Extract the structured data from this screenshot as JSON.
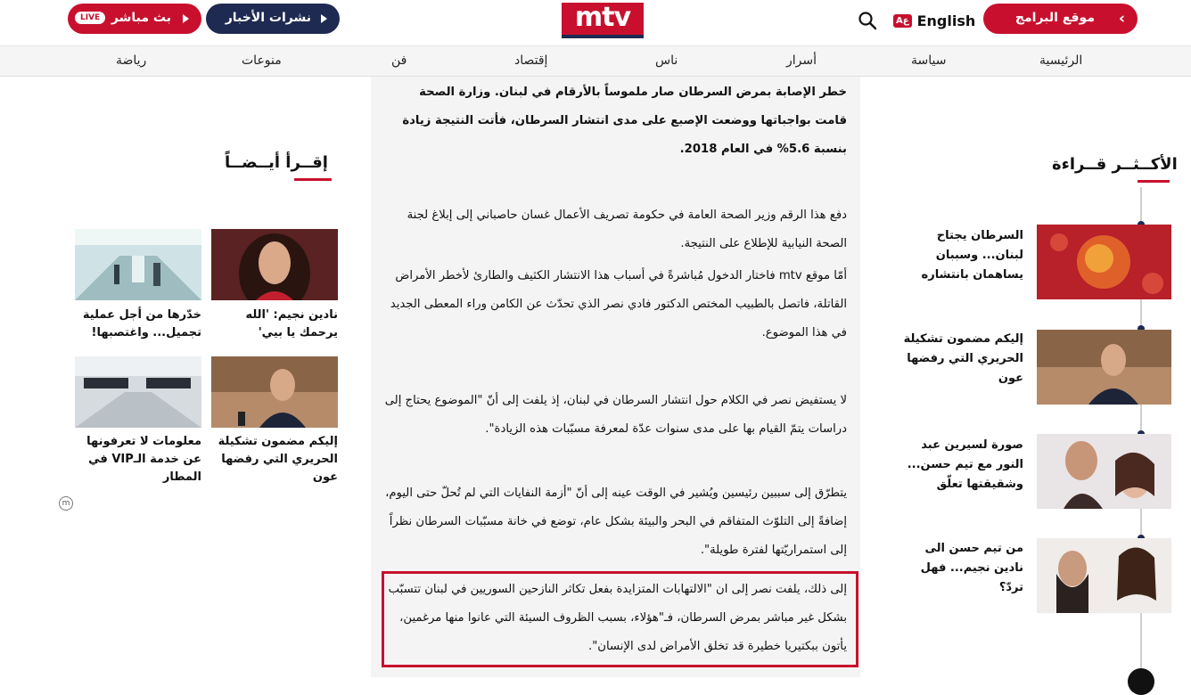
{
  "header": {
    "logo": "mtv",
    "live_label": "بث مباشر",
    "live_badge": "LIVE",
    "news_label": "نشرات الأخبار",
    "programs_label": "موقع البرامج",
    "lang_badge": "Aع",
    "lang_label": "English",
    "icons": [
      "search-icon",
      "play-icon",
      "chevron-left-icon"
    ]
  },
  "nav": {
    "items": [
      "الرئيسية",
      "سياسة",
      "أسرار",
      "ناس",
      "إقتصاد",
      "فن",
      "منوعات",
      "رياضة"
    ]
  },
  "article": {
    "p1": "خطر الإصابة بمرض السرطان صار ملموساً بالأرقام في لبنان. وزارة الصحة قامت بواجباتها ووضعت الإصبع على مدى انتشار السرطان، فأتت النتيجة زيادة بنسبة 5.6% في العام 2018.",
    "p2": "دفع هذا الرقم وزير الصحة العامة في حكومة تصريف الأعمال غسان حاصباني إلى إبلاغ لجنة الصحة النيابية للإطلاع على النتيجة.",
    "p3": "أمّا موقع mtv فاختار الدخول مُباشرةً في أسباب هذا الانتشار الكثيف والطارئ لأخطر الأمراض القاتلة، فاتصل بالطبيب المختص الدكتور فادي نصر الذي تحدّث عن الكامن وراء المعطى الجديد في هذا الموضوع.",
    "p4": "لا يستفيض نصر في الكلام حول انتشار السرطان في لبنان، إذ يلفت إلى أنّ \"الموضوع يحتاج إلى دراسات يتمّ القيام بها على مدى سنوات عدّة لمعرفة مسبّبات هذه الزيادة\".",
    "p5": "يتطرّق إلى سببين رئيسين ويُشير في الوقت عينه إلى أنّ \"أزمة النفايات التي لم تُحلّ حتى اليوم، إضافةً إلى التلوّث المتفاقم في البحر والبيئة بشكل عام، توضع في خانة مسبّبات السرطان نظراً إلى استمراريّتها لفترة طويلة\".",
    "p6": "إلى ذلك، يلفت نصر إلى ان \"الالتهابات المتزايدة بفعل تكاثر النازحين السوريين في لبنان تتسبّب بشكل غير مباشر بمرض السرطان، فـ\"هؤلاء، بسبب الظروف السيئة التي عانوا منها مرغمين، يأتون ببكتيريا خطيرة قد تخلق الأمراض لدى الإنسان\"."
  },
  "read_also": {
    "title": "إقــرأ أيــضــاً",
    "cards": [
      {
        "title": "نادين نجيم: 'الله يرحمك يا بيي'"
      },
      {
        "title": "خدّرها من أجل عملية تجميل... واغتصبها!"
      },
      {
        "title": "إليكم مضمون تشكيلة الحريري التي رفضها عون"
      },
      {
        "title": "معلومات لا تعرفونها عن خدمة الـVIP في المطار"
      }
    ]
  },
  "most_read": {
    "title": "الأكــثــر قــراءة",
    "items": [
      {
        "title": "السرطان يجتاح لبنان... وسببان يساهمان بانتشاره"
      },
      {
        "title": "إليكم مضمون تشكيلة الحريري التي رفضها عون"
      },
      {
        "title": "صورة لسيرين عبد النور مع تيم حسن... وشقيقتها تعلّق"
      },
      {
        "title": "من تيم حسن الى نادين نجيم... فهل تردّ؟"
      }
    ]
  },
  "colors": {
    "brand_red": "#c8102e",
    "navy": "#1f2a52"
  }
}
